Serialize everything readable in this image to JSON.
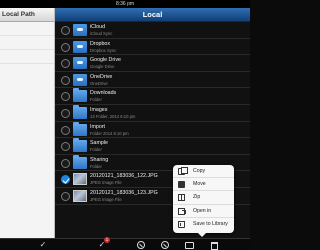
{
  "status_bar": {
    "time": "8:36 pm"
  },
  "left_pane": {
    "title": "Local Path"
  },
  "right_pane": {
    "title": "Local",
    "items": [
      {
        "name": "iCloud",
        "sub": "iCloud Sync",
        "kind": "cloud",
        "checked": false
      },
      {
        "name": "Dropbox",
        "sub": "Dropbox Sync",
        "kind": "cloud",
        "checked": false
      },
      {
        "name": "Google Drive",
        "sub": "Google Drive",
        "kind": "cloud",
        "checked": false
      },
      {
        "name": "OneDrive",
        "sub": "OneDrive",
        "kind": "cloud",
        "checked": false
      },
      {
        "name": "Downloads",
        "sub": "Folder",
        "kind": "folder",
        "checked": false
      },
      {
        "name": "Images",
        "sub": "13 Folder, 2014 6:10 pm",
        "kind": "folder",
        "checked": false
      },
      {
        "name": "Import",
        "sub": "Folder 2014 6:10 pm",
        "kind": "folder",
        "checked": false
      },
      {
        "name": "Sample",
        "sub": "Folder",
        "kind": "folder",
        "checked": false
      },
      {
        "name": "Sharing",
        "sub": "Folder",
        "kind": "folder",
        "checked": false
      },
      {
        "name": "20120121_183036_122.JPG",
        "sub": "JPEG Image File",
        "kind": "image",
        "checked": true
      },
      {
        "name": "20120121_183036_123.JPG",
        "sub": "JPEG Image File",
        "kind": "image",
        "checked": false
      }
    ]
  },
  "popup_menu": {
    "items": [
      {
        "label": "Copy",
        "icon": "copy-icon"
      },
      {
        "label": "Move",
        "icon": "move-icon"
      },
      {
        "label": "Zip",
        "icon": "zip-icon"
      },
      {
        "label": "Open in",
        "icon": "open-in-icon"
      },
      {
        "label": "Save to Library",
        "icon": "save-library-icon"
      }
    ]
  },
  "toolbar": {
    "badge_count": "1",
    "check_glyph": "✓",
    "button_glyph": "✓"
  }
}
